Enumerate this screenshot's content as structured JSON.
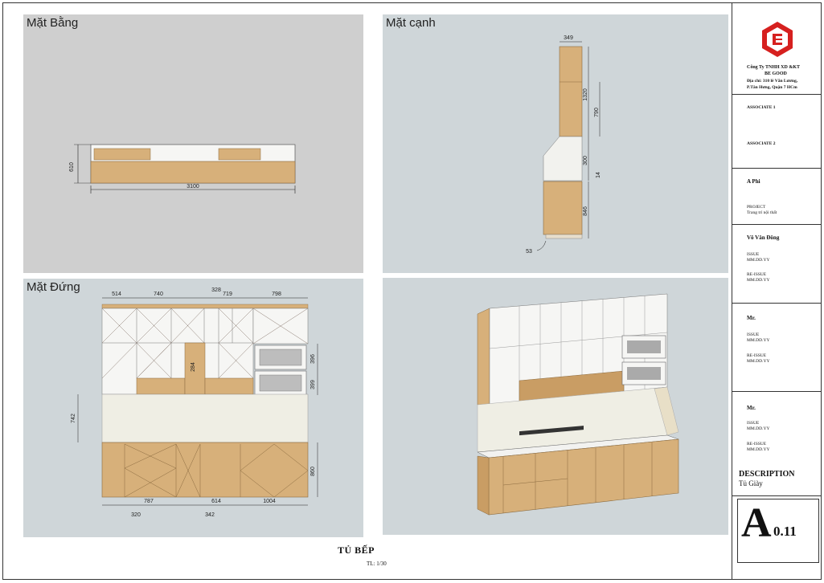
{
  "views": {
    "plan": {
      "title": "Mặt Bằng",
      "dims": {
        "width": "3100",
        "depth": "610"
      }
    },
    "side": {
      "title": "Mặt cạnh",
      "dims": {
        "top": "349",
        "upper_total": "1320",
        "upper_cab": "790",
        "backsplash": "300",
        "counter": "14",
        "lower": "846",
        "toe": "53"
      }
    },
    "elevation": {
      "title": "Mặt Đứng",
      "dims": {
        "top_a": "514",
        "top_b": "740",
        "top_c": "328",
        "top_d": "719",
        "top_e": "798",
        "backsplash": "742",
        "inner": "284",
        "oven_a": "396",
        "oven_b": "399",
        "lower": "860",
        "bot_a": "787",
        "bot_b": "614",
        "bot_c": "1004",
        "bot_d": "320",
        "bot_e": "342"
      }
    },
    "perspective": {
      "title": ""
    }
  },
  "title_block": {
    "company": "Công Ty TNHH XD &KT",
    "brand": "BE GOOD",
    "address1": "Địa chỉ: 310 lê Văn Lương,",
    "address2": "P.Tân Hưng, Quận 7 HCm",
    "associate1": "ASSOCIATE 1",
    "associate2": "ASSOCIATE 2",
    "client": "A Phi",
    "project_label": "PROJECT",
    "project_name": "Trang trí nội thất",
    "designer": "Võ Văn Đông",
    "issue1": "ISSUE",
    "issue1_date": "MM.DD.YY",
    "reissue1": "RE-ISSUE",
    "reissue1_date": "MM.DD.YY",
    "mr1": "Mr.",
    "issue2": "ISSUE",
    "issue2_date": "MM.DD.YY",
    "reissue2": "RE-ISSUE",
    "reissue2_date": "MM.DD.YY",
    "mr2": "Mr.",
    "issue3": "ISSUE",
    "issue3_date": "MM.DD.YY",
    "reissue3": "RE-ISSUE",
    "reissue3_date": "MM.DD.YY",
    "description_label": "DESCRIPTION",
    "description": "Tủ Giày",
    "sheet_letter": "A",
    "sheet_number": "0.11"
  },
  "drawing_title": "TỦ BẾP",
  "scale": "TL: 1/30",
  "colors": {
    "wood": "#d7b07a",
    "wood_dark": "#b88d55",
    "cream": "#efeee4",
    "white": "#f6f6f4",
    "viewport": "#cfcfcf",
    "logo_red": "#d6201f"
  }
}
